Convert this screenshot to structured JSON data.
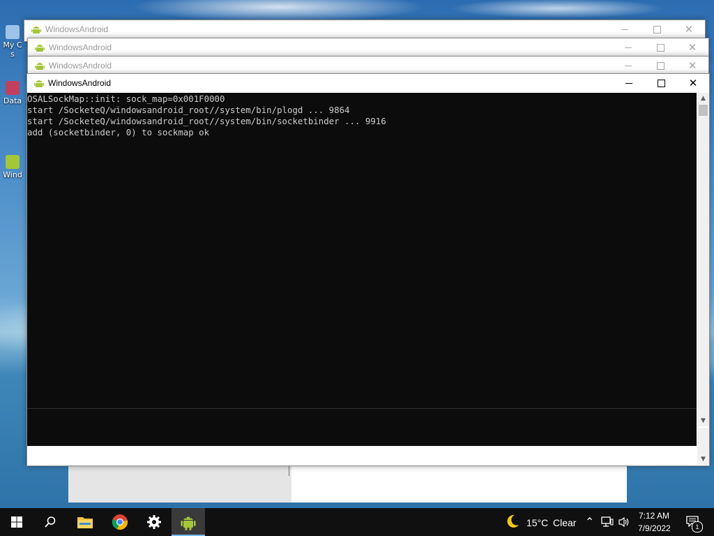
{
  "desktop": {
    "icons": [
      {
        "label": "My C",
        "sub": "s"
      },
      {
        "label": "Data"
      },
      {
        "label": "Wind"
      }
    ]
  },
  "windows": [
    {
      "title": "WindowsAndroid",
      "state": "inactive"
    },
    {
      "title": "WindowsAndroid",
      "state": "inactive"
    },
    {
      "title": "WindowsAndroid",
      "state": "inactive"
    },
    {
      "title": "WindowsAndroid",
      "state": "active"
    }
  ],
  "window_controls": {
    "minimize": "—",
    "maximize": "□",
    "close": "✕"
  },
  "console": {
    "lines": [
      "OSALSockMap::init: sock_map=0x001F0000",
      "start /SocketeQ/windowsandroid_root//system/bin/plogd ... 9864",
      "start /SocketeQ/windowsandroid_root//system/bin/socketbinder ... 9916",
      "add (socketbinder, 0) to sockmap ok"
    ],
    "background": "#0c0c0c",
    "text_color": "#cccccc"
  },
  "taskbar": {
    "apps": [
      {
        "name": "start",
        "icon": "windows-start-icon"
      },
      {
        "name": "search",
        "icon": "search-icon"
      },
      {
        "name": "file-explorer",
        "icon": "folder-icon"
      },
      {
        "name": "chrome",
        "icon": "chrome-icon"
      },
      {
        "name": "settings",
        "icon": "gear-icon"
      },
      {
        "name": "windowsandroid",
        "icon": "android-icon",
        "active": true
      }
    ],
    "weather": {
      "temp": "15°C",
      "condition": "Clear",
      "icon": "moon-icon"
    },
    "clock": {
      "time": "7:12 AM",
      "date": "7/9/2022"
    },
    "notifications": {
      "count": "1"
    }
  },
  "colors": {
    "android_green": "#a4c639",
    "accent": "#76b9ed"
  }
}
